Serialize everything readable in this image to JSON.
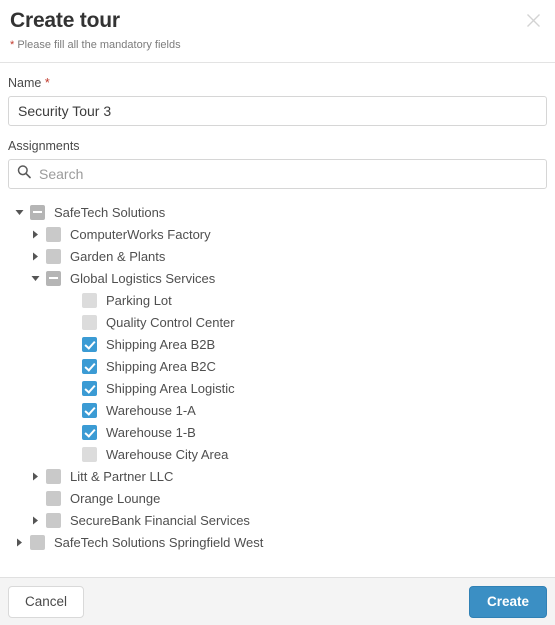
{
  "header": {
    "title": "Create tour",
    "mandatory_note_star": "*",
    "mandatory_note": " Please fill all the mandatory fields",
    "close_icon": "close-icon"
  },
  "form": {
    "name_label": "Name",
    "name_required_marker": "*",
    "name_value": "Security Tour 3",
    "name_placeholder": "",
    "assignments_label": "Assignments",
    "search_placeholder": "Search",
    "search_value": "",
    "search_icon": "search-icon"
  },
  "tree": {
    "nodes": [
      {
        "label": "SafeTech Solutions",
        "level": 0,
        "twisty": "expanded",
        "state": "indeterminate"
      },
      {
        "label": "ComputerWorks Factory",
        "level": 1,
        "twisty": "collapsed",
        "state": "unchecked"
      },
      {
        "label": "Garden & Plants",
        "level": 1,
        "twisty": "collapsed",
        "state": "unchecked"
      },
      {
        "label": "Global Logistics Services",
        "level": 1,
        "twisty": "expanded",
        "state": "indeterminate"
      },
      {
        "label": "Parking Lot",
        "level": 2,
        "twisty": "none",
        "state": "unchecked-leaf"
      },
      {
        "label": "Quality Control Center",
        "level": 2,
        "twisty": "none",
        "state": "unchecked-leaf"
      },
      {
        "label": "Shipping Area B2B",
        "level": 2,
        "twisty": "none",
        "state": "checked"
      },
      {
        "label": "Shipping Area B2C",
        "level": 2,
        "twisty": "none",
        "state": "checked"
      },
      {
        "label": "Shipping Area Logistic",
        "level": 2,
        "twisty": "none",
        "state": "checked"
      },
      {
        "label": "Warehouse 1-A",
        "level": 2,
        "twisty": "none",
        "state": "checked"
      },
      {
        "label": "Warehouse 1-B",
        "level": 2,
        "twisty": "none",
        "state": "checked"
      },
      {
        "label": "Warehouse City Area",
        "level": 2,
        "twisty": "none",
        "state": "unchecked-leaf"
      },
      {
        "label": "Litt & Partner LLC",
        "level": 1,
        "twisty": "collapsed",
        "state": "unchecked"
      },
      {
        "label": "Orange Lounge",
        "level": 1,
        "twisty": "none",
        "state": "unchecked"
      },
      {
        "label": "SecureBank Financial Services",
        "level": 1,
        "twisty": "collapsed",
        "state": "unchecked"
      },
      {
        "label": "SafeTech Solutions Springfield West",
        "level": 0,
        "twisty": "collapsed",
        "state": "unchecked"
      }
    ]
  },
  "footer": {
    "cancel_label": "Cancel",
    "create_label": "Create"
  },
  "colors": {
    "accent_blue": "#3b9bd4",
    "create_button": "#3b8fc4",
    "required_red": "#c0392b",
    "footer_bg": "#f4f4f4"
  }
}
